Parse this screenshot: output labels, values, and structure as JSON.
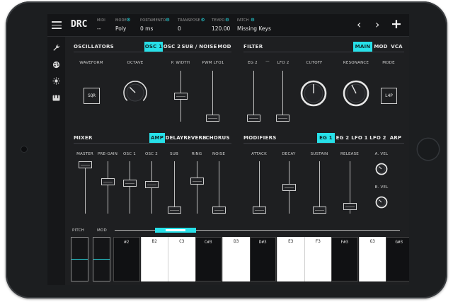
{
  "app": {
    "title": "DRC"
  },
  "header": {
    "fields": [
      {
        "label": "MIDI",
        "value": "--",
        "has_gear": false
      },
      {
        "label": "MODE",
        "value": "Poly",
        "has_gear": true
      },
      {
        "label": "PORTAMENTO",
        "value": "0 ms",
        "has_gear": true
      },
      {
        "label": "TRANSPOSE",
        "value": "0",
        "has_gear": true
      },
      {
        "label": "TEMPO",
        "value": "120.00",
        "has_gear": true
      },
      {
        "label": "PATCH",
        "value": "Missing Keys",
        "has_gear": true
      }
    ],
    "prev_glyph": "‹",
    "next_glyph": "›",
    "add_glyph": "+"
  },
  "sidebar": {
    "icons": [
      "wrench-icon",
      "palette-icon",
      "sun-icon",
      "piano-icon"
    ]
  },
  "oscillators": {
    "title": "OSCILLATORS",
    "tabs": [
      "OSC 1",
      "OSC 2",
      "SUB / NOISE",
      "MOD"
    ],
    "active_tab": 0,
    "labels": {
      "waveform": "WAVEFORM",
      "octave": "OCTAVE",
      "pwidth": "P. WIDTH",
      "pwmlfo": "PWM LFO1"
    },
    "waveform_button": "SQR",
    "pwidth_level": 0.5,
    "pwmlfo_level": 0.0
  },
  "filter": {
    "title": "FILTER",
    "tabs": [
      "MAIN",
      "MOD",
      "VCA"
    ],
    "active_tab": 0,
    "labels": {
      "eg2": "EG 2",
      "dash": "—",
      "lfo2": "LFO 2",
      "cutoff": "CUTOFF",
      "resonance": "RESONANCE",
      "mode": "MODE"
    },
    "mode_button": "L4P",
    "eg2_level": 0.0,
    "lfo2_level": 0.0
  },
  "mixer": {
    "title": "MIXER",
    "tabs": [
      "AMP",
      "DELAY",
      "REVERB",
      "CHORUS"
    ],
    "active_tab": 0,
    "sliders": [
      {
        "label": "MASTER",
        "level": 1.0
      },
      {
        "label": "PRE-GAIN",
        "level": 0.62
      },
      {
        "label": "OSC 1",
        "level": 0.6
      },
      {
        "label": "OSC 2",
        "level": 0.57
      },
      {
        "label": "SUB",
        "level": 0.0
      },
      {
        "label": "RING",
        "level": 0.64
      },
      {
        "label": "NOISE",
        "level": 0.0
      }
    ]
  },
  "modifiers": {
    "title": "MODIFIERS",
    "tabs": [
      "EG 1",
      "EG 2",
      "LFO 1",
      "LFO 2",
      "ARP"
    ],
    "active_tab": 0,
    "sliders": [
      {
        "label": "ATTACK",
        "level": 0.0
      },
      {
        "label": "DECAY",
        "level": 0.5
      },
      {
        "label": "SUSTAIN",
        "level": 0.0
      },
      {
        "label": "RELEASE",
        "level": 0.08
      }
    ],
    "knobs": {
      "avel": "A. VEL",
      "bvel": "B. VEL"
    }
  },
  "keyboard": {
    "pitch_label": "PITCH",
    "mod_label": "MOD",
    "keys": [
      {
        "label": "#2",
        "type": "black"
      },
      {
        "label": "B2",
        "type": "white"
      },
      {
        "label": "C3",
        "type": "white"
      },
      {
        "label": "C#3",
        "type": "black"
      },
      {
        "label": "D3",
        "type": "white"
      },
      {
        "label": "D#3",
        "type": "black"
      },
      {
        "label": "E3",
        "type": "white"
      },
      {
        "label": "F3",
        "type": "white"
      },
      {
        "label": "F#3",
        "type": "black"
      },
      {
        "label": "G3",
        "type": "white"
      },
      {
        "label": "G#3",
        "type": "black"
      }
    ]
  },
  "colors": {
    "accent": "#27e0e8",
    "panel": "#1e1f21",
    "bar": "#141517"
  }
}
